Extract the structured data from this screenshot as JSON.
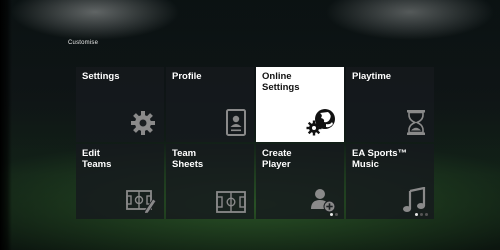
{
  "page_title": "Customise",
  "tiles": [
    {
      "label": "Settings",
      "icon": "gear-icon"
    },
    {
      "label": "Profile",
      "icon": "id-card-icon"
    },
    {
      "label": "Online\nSettings",
      "icon": "globe-gear-icon"
    },
    {
      "label": "Playtime",
      "icon": "hourglass-icon"
    },
    {
      "label": "Edit\nTeams",
      "icon": "pitch-edit-icon"
    },
    {
      "label": "Team\nSheets",
      "icon": "pitch-icon"
    },
    {
      "label": "Create\nPlayer",
      "icon": "add-user-icon"
    },
    {
      "label": "EA Sports™\nMusic",
      "icon": "music-note-icon"
    }
  ],
  "selected_tile": "Online Settings",
  "colors": {
    "tile_bg": "#161a1d",
    "selected_bg": "#ffffff",
    "icon_gray": "#8a8a8a"
  }
}
